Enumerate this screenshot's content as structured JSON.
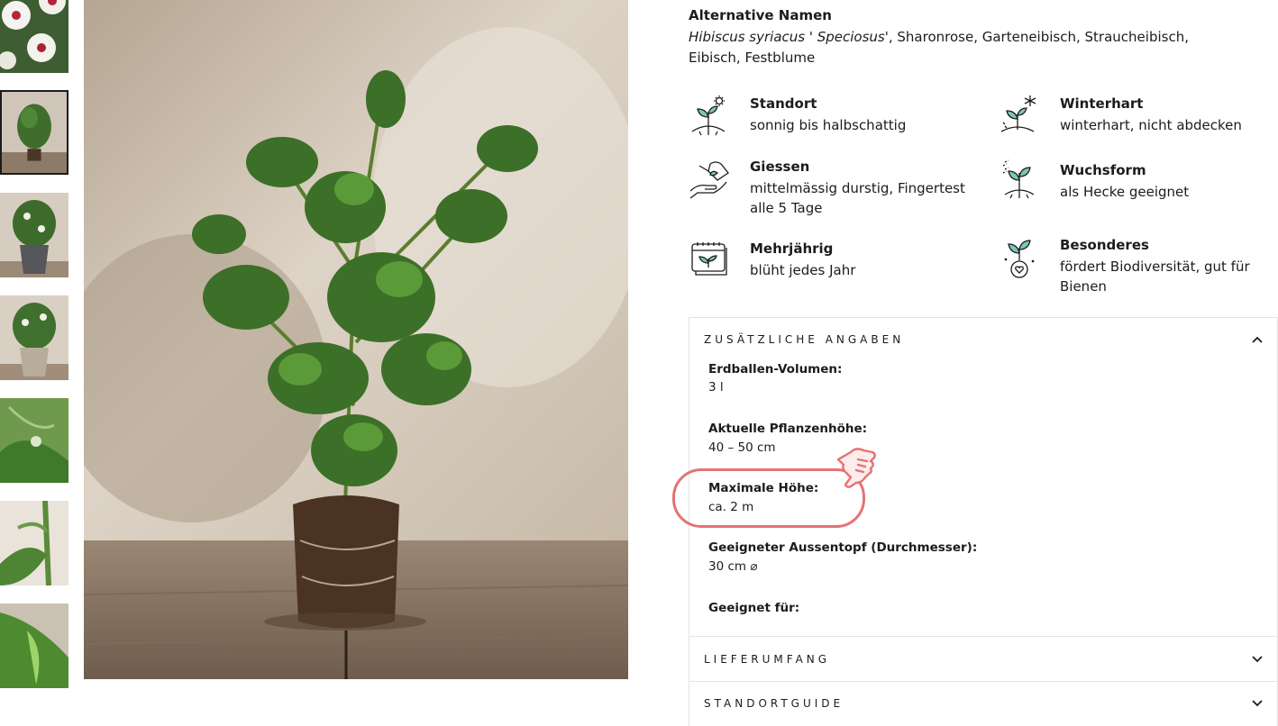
{
  "thumbnails": [
    {
      "name": "thumb-flower-white",
      "active": false
    },
    {
      "name": "thumb-plant-rootball",
      "active": true
    },
    {
      "name": "thumb-plant-pot-grey",
      "active": false
    },
    {
      "name": "thumb-plant-pot-beige",
      "active": false
    },
    {
      "name": "thumb-leaf-closeup",
      "active": false
    },
    {
      "name": "thumb-stem-closeup",
      "active": false
    },
    {
      "name": "thumb-leaves-closeup",
      "active": false
    }
  ],
  "alternative_names": {
    "title": "Alternative Namen",
    "italic_part": "Hibiscus syriacus ' Speciosus'",
    "rest": ", Sharonrose, Garteneibisch, Straucheibisch, Eibisch, Festblume"
  },
  "features": [
    {
      "icon": "sun-sprout-icon",
      "title": "Standort",
      "text": "sonnig bis halbschattig"
    },
    {
      "icon": "snowflake-sprout-icon",
      "title": "Winterhart",
      "text": "winterhart, nicht abdecken"
    },
    {
      "icon": "watering-can-icon",
      "title": "Giessen",
      "text": "mittelmässig durstig, Fingertest alle 5 Tage"
    },
    {
      "icon": "growth-form-icon",
      "title": "Wuchsform",
      "text": "als Hecke geeignet"
    },
    {
      "icon": "calendar-sprout-icon",
      "title": "Mehrjährig",
      "text": "blüht jedes Jahr"
    },
    {
      "icon": "heart-sprout-icon",
      "title": "Besonderes",
      "text": "fördert Biodiversität, gut für Bienen"
    }
  ],
  "accordion": {
    "additional": {
      "title": "ZUSÄTZLICHE ANGABEN",
      "properties": [
        {
          "label": "Erdballen-Volumen:",
          "value": "3 l"
        },
        {
          "label": "Aktuelle Pflanzenhöhe:",
          "value": "40 – 50 cm"
        },
        {
          "label": "Maximale Höhe:",
          "value": "ca. 2 m"
        },
        {
          "label": "Geeigneter Aussentopf (Durchmesser):",
          "value": "30 cm ⌀"
        },
        {
          "label": "Geeignet für:",
          "value": ""
        }
      ]
    },
    "delivery": {
      "title": "LIEFERUMFANG"
    },
    "location_guide": {
      "title": "STANDORTGUIDE"
    }
  },
  "colors": {
    "highlight": "#e57373",
    "leaf_accent": "#7cc6b6",
    "text": "#1c1c1c",
    "border": "#e3e3e3"
  }
}
